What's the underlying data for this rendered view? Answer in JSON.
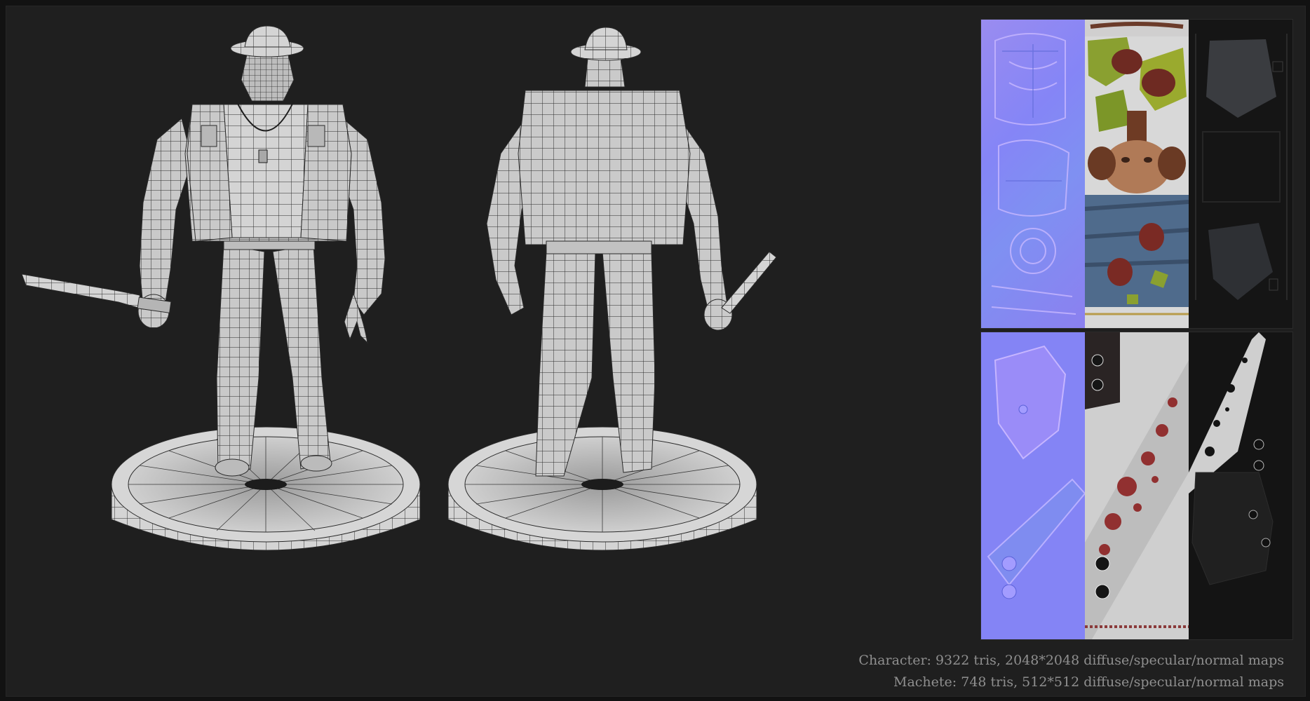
{
  "views": [
    {
      "id": "front",
      "label": "front wireframe view"
    },
    {
      "id": "back",
      "label": "back wireframe view"
    }
  ],
  "textures": {
    "character_sheet": [
      "normal map",
      "diffuse map",
      "specular map"
    ],
    "machete_sheet": [
      "normal map",
      "diffuse map",
      "specular map"
    ]
  },
  "colors": {
    "background": "#1f1f1f",
    "model_fill": "#c9c9c9",
    "wire": "#2a2a2a",
    "normal_map": "#8484f5",
    "diffuse_light": "#d9d9d9",
    "specular_dark": "#141414",
    "caption": "#8f8f8f"
  },
  "captions": {
    "character": "Character: 9322 tris, 2048*2048 diffuse/specular/normal maps",
    "machete": "Machete: 748 tris, 512*512 diffuse/specular/normal maps"
  }
}
